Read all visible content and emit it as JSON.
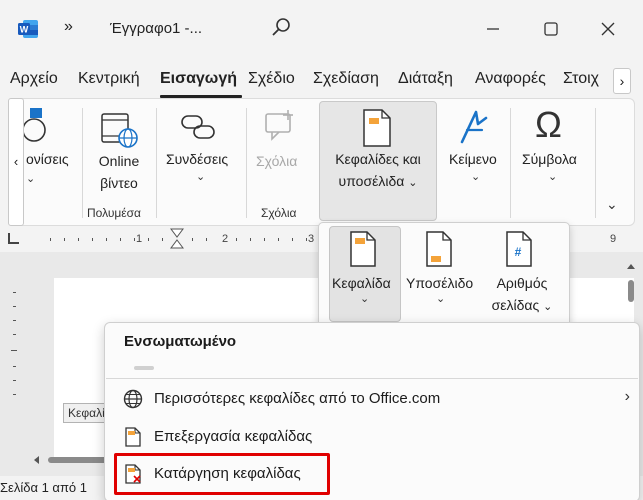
{
  "titlebar": {
    "overflow_label": "»",
    "doc_title": "Έγγραφο1  -...",
    "minimize": "—",
    "maximize": "☐",
    "close": "✕"
  },
  "menu_tabs": [
    {
      "label": "Αρχείο"
    },
    {
      "label": "Κεντρική"
    },
    {
      "label": "Εισαγωγή"
    },
    {
      "label": "Σχέδιο"
    },
    {
      "label": "Σχεδίαση"
    },
    {
      "label": "Διάταξη"
    },
    {
      "label": "Αναφορές"
    },
    {
      "label": "Στοιχ"
    }
  ],
  "tab_scroll_label": "›",
  "ribbon": {
    "left_scroll": "‹",
    "shapes_label": "ονίσεις",
    "online_video_line1": "Online",
    "online_video_line2": "βίντεο",
    "media_group": "Πολυμέσα",
    "links_label": "Συνδέσεις",
    "comments_label": "Σχόλια",
    "comments_group": "Σχόλια",
    "header_footer_line1": "Κεφαλίδες και",
    "header_footer_line2": "υποσέλιδα",
    "text_label": "Κείμενο",
    "symbols_label": "Σύμβολα",
    "expand": "⌄"
  },
  "ruler": {
    "nums": [
      "1",
      "2",
      "3",
      "9"
    ]
  },
  "submenu": {
    "header_label": "Κεφαλίδα",
    "footer_label": "Υποσέλιδο",
    "page_number_line1": "Αριθμός",
    "page_number_line2": "σελίδας"
  },
  "dropdown": {
    "heading": "Ενσωματωμένο",
    "items": [
      {
        "label": "Περισσότερες κεφαλίδες από το Office.com",
        "has_submenu": true
      },
      {
        "label": "Επεξεργασία κεφαλίδας"
      },
      {
        "label": "Κατάργηση κεφαλίδας"
      }
    ]
  },
  "document": {
    "header_tag": "Κεφαλί"
  },
  "status": {
    "page_info": "Σελίδα 1 από 1"
  },
  "colors": {
    "word_blue": "#185abd",
    "icon_orange": "#f4a33a",
    "accent_blue": "#1a73c8",
    "highlight_red": "#e00000"
  }
}
